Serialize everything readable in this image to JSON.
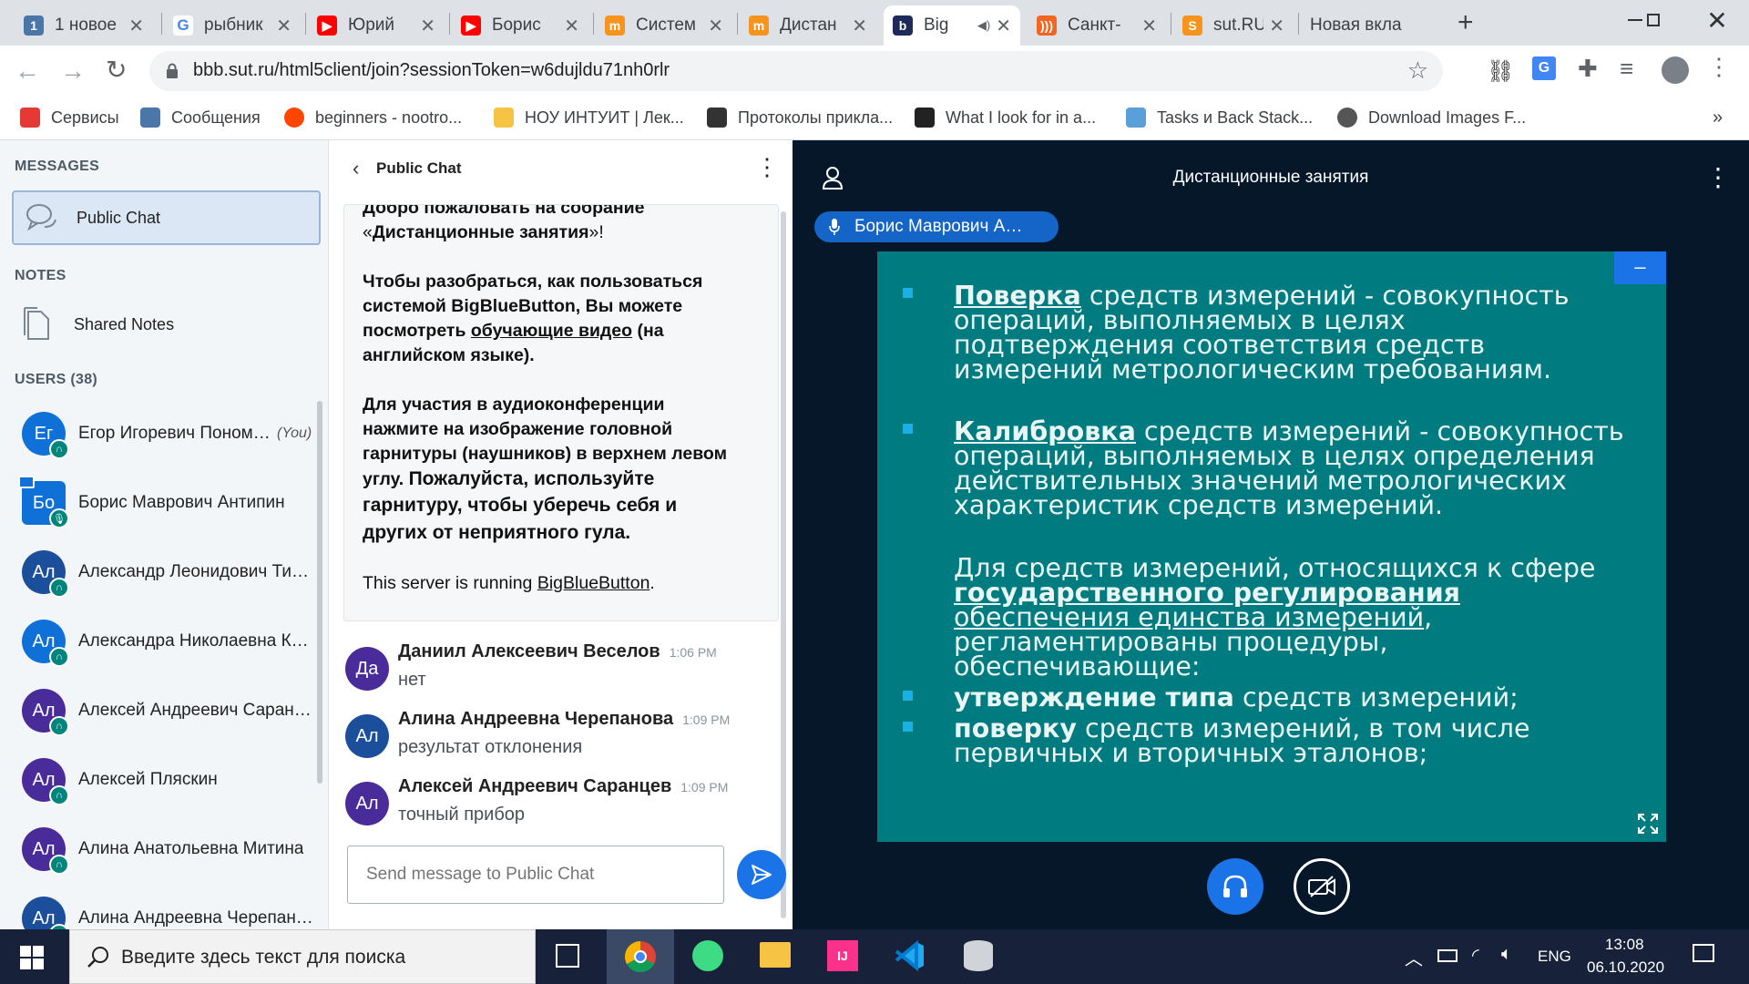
{
  "browser": {
    "tabs": [
      {
        "label": "1 новое",
        "favicon": "vk-icon",
        "color": "#4a76a8",
        "glyph": "1"
      },
      {
        "label": "рыбник",
        "favicon": "google-icon",
        "color": "#ffffff",
        "glyph": "G"
      },
      {
        "label": "Юрий",
        "favicon": "youtube-icon",
        "color": "#ff0000",
        "glyph": "▶"
      },
      {
        "label": "Борис",
        "favicon": "youtube-icon",
        "color": "#ff0000",
        "glyph": "▶"
      },
      {
        "label": "Систем",
        "favicon": "moodle-icon",
        "color": "#f7941d",
        "glyph": "m"
      },
      {
        "label": "Дистан",
        "favicon": "moodle-icon",
        "color": "#f7941d",
        "glyph": "m"
      },
      {
        "label": "Big",
        "favicon": "bigbluebutton-icon",
        "color": "#1e2a5a",
        "glyph": "b",
        "active": true
      },
      {
        "label": "Санкт-",
        "favicon": "rss-icon",
        "color": "#f26522",
        "glyph": ")))"
      },
      {
        "label": "sut.RU",
        "favicon": "sut-icon",
        "color": "#f7941d",
        "glyph": "S"
      },
      {
        "label": "Новая вкла",
        "favicon": "",
        "color": "",
        "glyph": ""
      }
    ],
    "new_tab_label": "+",
    "address": "bbb.sut.ru/html5client/join?sessionToken=w6dujldu71nh0rlr",
    "bookmarks": [
      {
        "label": "Сервисы",
        "icon": "apps-grid-icon"
      },
      {
        "label": "Сообщения",
        "icon": "messages-icon"
      },
      {
        "label": "beginners - nootro...",
        "icon": "reddit-icon"
      },
      {
        "label": "НОУ ИНТУИТ | Лек...",
        "icon": "intuit-icon"
      },
      {
        "label": "Протоколы прикла...",
        "icon": "wikipedia-icon"
      },
      {
        "label": "What I look for in a...",
        "icon": "fad-icon"
      },
      {
        "label": "Tasks и Back Stack...",
        "icon": "android-icon"
      },
      {
        "label": "Download Images F...",
        "icon": "download-icon"
      }
    ],
    "more_bookmarks": "»"
  },
  "sidebar": {
    "messages_heading": "MESSAGES",
    "public_chat": "Public Chat",
    "notes_heading": "NOTES",
    "shared_notes": "Shared Notes",
    "users_heading": "USERS (38)",
    "users": [
      {
        "initials": "Ег",
        "name": "Егор Игоревич Понома…",
        "suffix": "(You)",
        "color": "#0f70d7"
      },
      {
        "initials": "Бо",
        "name": "Борис Маврович Антипин",
        "suffix": "",
        "color": "#0f70d7",
        "presenter": true
      },
      {
        "initials": "Ал",
        "name": "Александр Леонидович Тит…",
        "suffix": "",
        "color": "#1b4f9c"
      },
      {
        "initials": "Ал",
        "name": "Александра Николаевна К…",
        "suffix": "",
        "color": "#0f70d7"
      },
      {
        "initials": "Ал",
        "name": "Алексей Андреевич Саран…",
        "suffix": "",
        "color": "#4a2b9a"
      },
      {
        "initials": "Ал",
        "name": "Алексей Пляскин",
        "suffix": "",
        "color": "#4a2b9a"
      },
      {
        "initials": "Ал",
        "name": "Алина Анатольевна Митина",
        "suffix": "",
        "color": "#4a2b9a"
      },
      {
        "initials": "Ал",
        "name": "Алина Андреевна Черепан…",
        "suffix": "",
        "color": "#1b4f9c"
      }
    ]
  },
  "chat": {
    "title": "Public Chat",
    "welcome": {
      "l1": "Добро пожаловать на собрание",
      "l2_prefix": "«",
      "l2_bold": "Дистанционные занятия",
      "l2_suffix": "»!",
      "p2_l1": "Чтобы разобраться, как пользоваться",
      "p2_l2_a": "системой BigBlueButton, ",
      "p2_l2_b": "Вы можете",
      "p2_l3_a": "посмотреть ",
      "p2_l3_link": "обучающие видео",
      "p2_l3_b": " (на",
      "p2_l4": "английском языке).",
      "p3_l1": "Для участия в аудиоконференции",
      "p3_l2": "нажмите на изображение головной",
      "p3_l3": "гарнитуры (наушников) в верхнем левом",
      "p3_l4_a": "углу. ",
      "p3_l4_b": "Пожалуйста, используйте",
      "p3_l5": "гарнитуру, чтобы уберечь себя и",
      "p3_l6": "других от неприятного гула.",
      "p4_a": "This server is running ",
      "p4_link": "BigBlueButton",
      "p4_b": "."
    },
    "messages": [
      {
        "initials": "Да",
        "name": "Даниил Алексеевич Веселов",
        "time": "1:06 PM",
        "text": "нет",
        "color": "#4a2b9a"
      },
      {
        "initials": "Ал",
        "name": "Алина Андреевна Черепанова",
        "time": "1:09 PM",
        "text": "результат отклонения",
        "color": "#1b4f9c"
      },
      {
        "initials": "Ал",
        "name": "Алексей Андреевич Саранцев",
        "time": "1:09 PM",
        "text": "точный прибор",
        "color": "#4a2b9a"
      }
    ],
    "input_placeholder": "Send message to Public Chat"
  },
  "presentation": {
    "title": "Дистанционные занятия",
    "presenter_label": "Борис Маврович А…",
    "slide": {
      "b1_bold": "Поверка",
      "b1_rest": " средств измерений - совокупность",
      "b1_l2": "операций, выполняемых в целях",
      "b1_l3": "подтверждения соответствия средств",
      "b1_l4": "измерений метрологическим требованиям.",
      "b2_bold": "Калибровка",
      "b2_rest": " средств измерений - совокупность",
      "b2_l2": "операций, выполняемых в целях определения",
      "b2_l3": "действительных значений метрологических",
      "b2_l4": "характеристик средств измерений.",
      "p_l1": "Для средств измерений, относящихся к сфере",
      "p_l2": "государственного регулирования",
      "p_l3_u": "обеспечения единства измерений",
      "p_l3_rest": ",",
      "p_l4": "регламентированы процедуры,",
      "p_l5": "обеспечивающие:",
      "b3_bold": "утверждение типа",
      "b3_rest": " средств измерений;",
      "b4_bold": "поверку",
      "b4_rest": " средств измерений, в том числе",
      "b4_l2": "первичных и вторичных эталонов;"
    },
    "minimize_label": "–"
  },
  "taskbar": {
    "search_placeholder": "Введите здесь текст для поиска",
    "lang": "ENG",
    "time": "13:08",
    "date": "06.10.2020"
  }
}
